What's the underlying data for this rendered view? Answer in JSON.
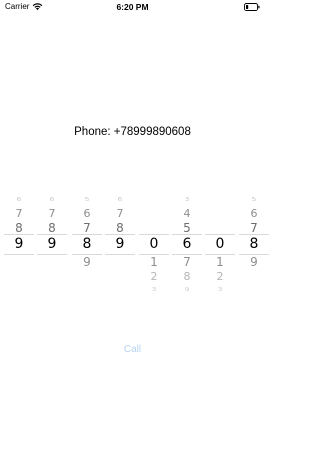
{
  "status_bar": {
    "carrier": "Carrier",
    "time": "6:20 PM",
    "icons": [
      "wifi-icon",
      "battery-icon"
    ]
  },
  "phone_label": "Phone: +78999890608",
  "picker": {
    "columns": [
      {
        "above": [
          "6",
          "7",
          "8"
        ],
        "selected": "9",
        "below": []
      },
      {
        "above": [
          "6",
          "7",
          "8"
        ],
        "selected": "9",
        "below": []
      },
      {
        "above": [
          "5",
          "6",
          "7"
        ],
        "selected": "8",
        "below": [
          "9"
        ]
      },
      {
        "above": [
          "6",
          "7",
          "8"
        ],
        "selected": "9",
        "below": []
      },
      {
        "above": [],
        "selected": "0",
        "below": [
          "1",
          "2",
          "3"
        ]
      },
      {
        "above": [
          "3",
          "4",
          "5"
        ],
        "selected": "6",
        "below": [
          "7",
          "8",
          "9"
        ]
      },
      {
        "above": [],
        "selected": "0",
        "below": [
          "1",
          "2",
          "3"
        ]
      },
      {
        "above": [
          "5",
          "6",
          "7"
        ],
        "selected": "8",
        "below": [
          "9"
        ]
      }
    ]
  },
  "call_button": {
    "label": "Call",
    "color": "#b8d4f3"
  }
}
